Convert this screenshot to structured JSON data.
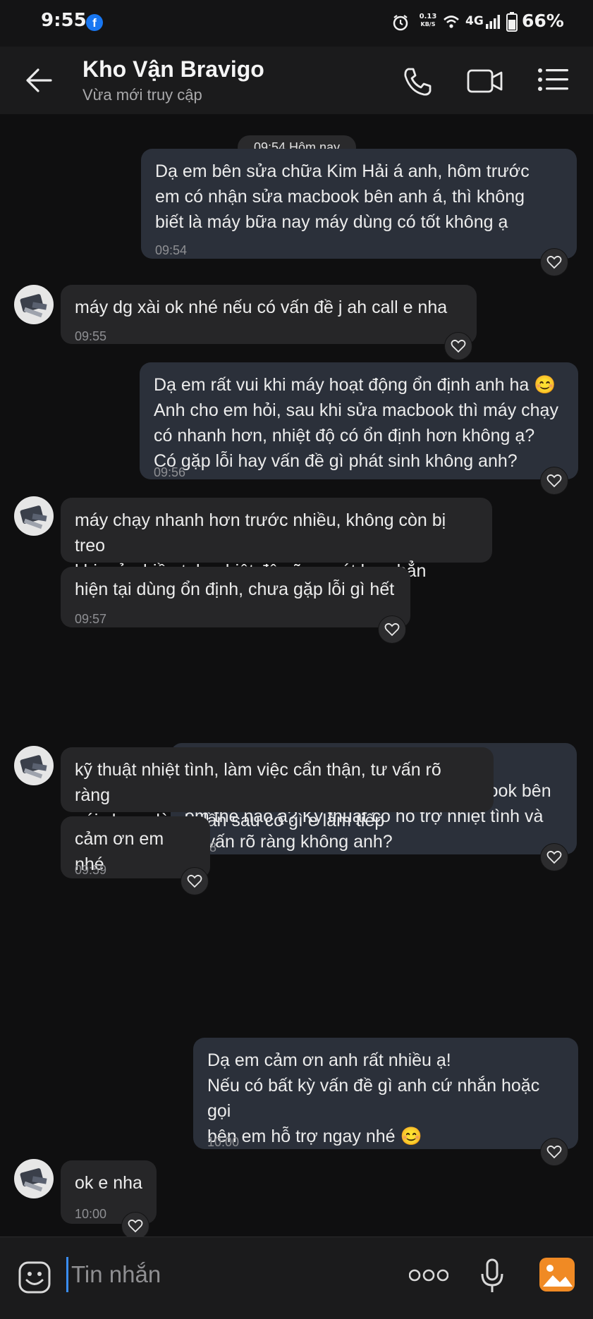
{
  "status_bar": {
    "time": "9:55",
    "app_badge": "f",
    "net_speed_value": "0.13",
    "net_speed_unit": "KB/S",
    "network": "4G",
    "battery": "66%"
  },
  "header": {
    "title": "Kho Vận Bravigo",
    "subtitle": "Vừa mới truy cập"
  },
  "chat": {
    "date_chip": "09:54 Hôm nay",
    "messages": [
      {
        "from": "me",
        "text": "Dạ em bên sửa chữa Kim Hải á anh, hôm trước\nem có nhận sửa macbook bên anh á, thì không\nbiết là máy bữa nay máy dùng có tốt không ạ",
        "time": "09:54"
      },
      {
        "from": "them",
        "text": "máy dg xài ok nhé nếu có vấn đề j ah call e nha",
        "time": "09:55"
      },
      {
        "from": "me",
        "text": "Dạ em rất vui khi máy hoạt động ổn định anh ha 😊\nAnh cho em hỏi, sau khi sửa macbook thì máy chạy\ncó nhanh hơn, nhiệt độ có ổn định hơn không ạ?\nCó gặp lỗi hay vấn đề gì phát sinh không anh?",
        "time": "09:56"
      },
      {
        "from": "them",
        "text": "máy chạy nhanh hơn trước nhiều, không còn bị treo\nkhi mở nhiều tab, nhiệt độ cũng mát hơn hẳn",
        "time": ""
      },
      {
        "from": "them",
        "text": "hiện tại dùng ổn định, chưa gặp lỗi gì hết",
        "time": "09:57"
      },
      {
        "from": "me",
        "text": "Dạ tuyệt vời quá ạ 😊\nAnh thấy chất lượng dịch vụ sửa macbook bên\nem thế nào ạ? Kỹ thuật có hỗ trợ nhiệt tình và\ntư vấn rõ ràng không anh?",
        "time": "09:58"
      },
      {
        "from": "them",
        "text": "kỹ thuật nhiệt tình, làm việc cẩn thận, tư vấn rõ ràng\nnói chung là ok, lần sau có gì e làm tiếp",
        "time": ""
      },
      {
        "from": "them",
        "text": "cảm ơn em nhé",
        "time": "09:59"
      },
      {
        "from": "me",
        "text": "Dạ em cảm ơn anh rất nhiều ạ!\nNếu có bất kỳ vấn đề gì anh cứ nhắn hoặc gọi\nbên em hỗ trợ ngay nhé 😊",
        "time": "10:00"
      },
      {
        "from": "them",
        "text": "ok e nha",
        "time": "10:00"
      }
    ]
  },
  "composer": {
    "placeholder": "Tin nhắn"
  },
  "colors": {
    "accent": "#3a8ef6",
    "outgoing_bubble": "#2b303a",
    "incoming_bubble": "#262628",
    "image_button": "#f08a24"
  }
}
